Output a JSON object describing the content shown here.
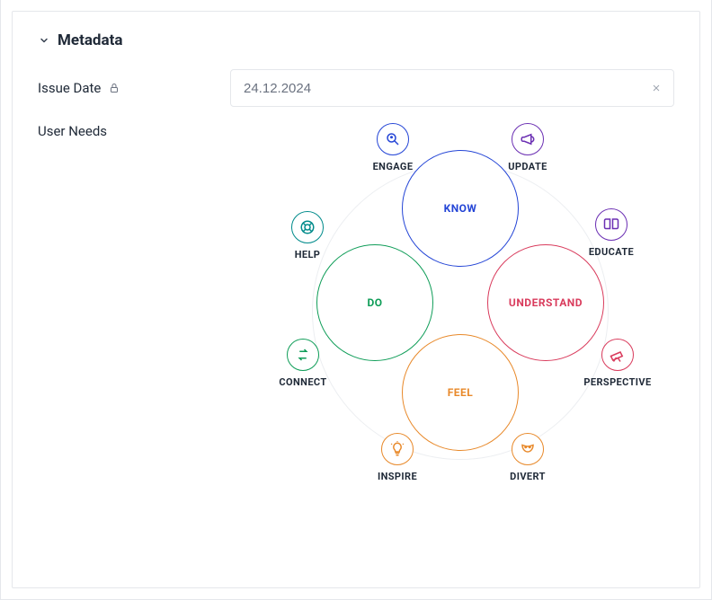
{
  "section": {
    "title": "Metadata"
  },
  "issueDate": {
    "label": "Issue Date",
    "value": "24.12.2024",
    "placeholder": "DD.MM.YYYY"
  },
  "userNeeds": {
    "label": "User Needs",
    "core": {
      "know": {
        "label": "KNOW",
        "color": "#2445d6"
      },
      "do": {
        "label": "DO",
        "color": "#0f9d58"
      },
      "understand": {
        "label": "UNDERSTAND",
        "color": "#d93b5c"
      },
      "feel": {
        "label": "FEEL",
        "color": "#e8892a"
      }
    },
    "nodes": {
      "engage": {
        "label": "ENGAGE",
        "color": "#2445d6",
        "icon": "search-person"
      },
      "update": {
        "label": "UPDATE",
        "color": "#6b2fb3",
        "icon": "megaphone"
      },
      "educate": {
        "label": "EDUCATE",
        "color": "#6b2fb3",
        "icon": "book"
      },
      "perspective": {
        "label": "PERSPECTIVE",
        "color": "#d93b5c",
        "icon": "telescope"
      },
      "divert": {
        "label": "DIVERT",
        "color": "#e8892a",
        "icon": "masks"
      },
      "inspire": {
        "label": "INSPIRE",
        "color": "#e8892a",
        "icon": "lightbulb"
      },
      "connect": {
        "label": "CONNECT",
        "color": "#0f9d58",
        "icon": "arrows"
      },
      "help": {
        "label": "HELP",
        "color": "#008b8b",
        "icon": "lifebuoy"
      }
    }
  }
}
